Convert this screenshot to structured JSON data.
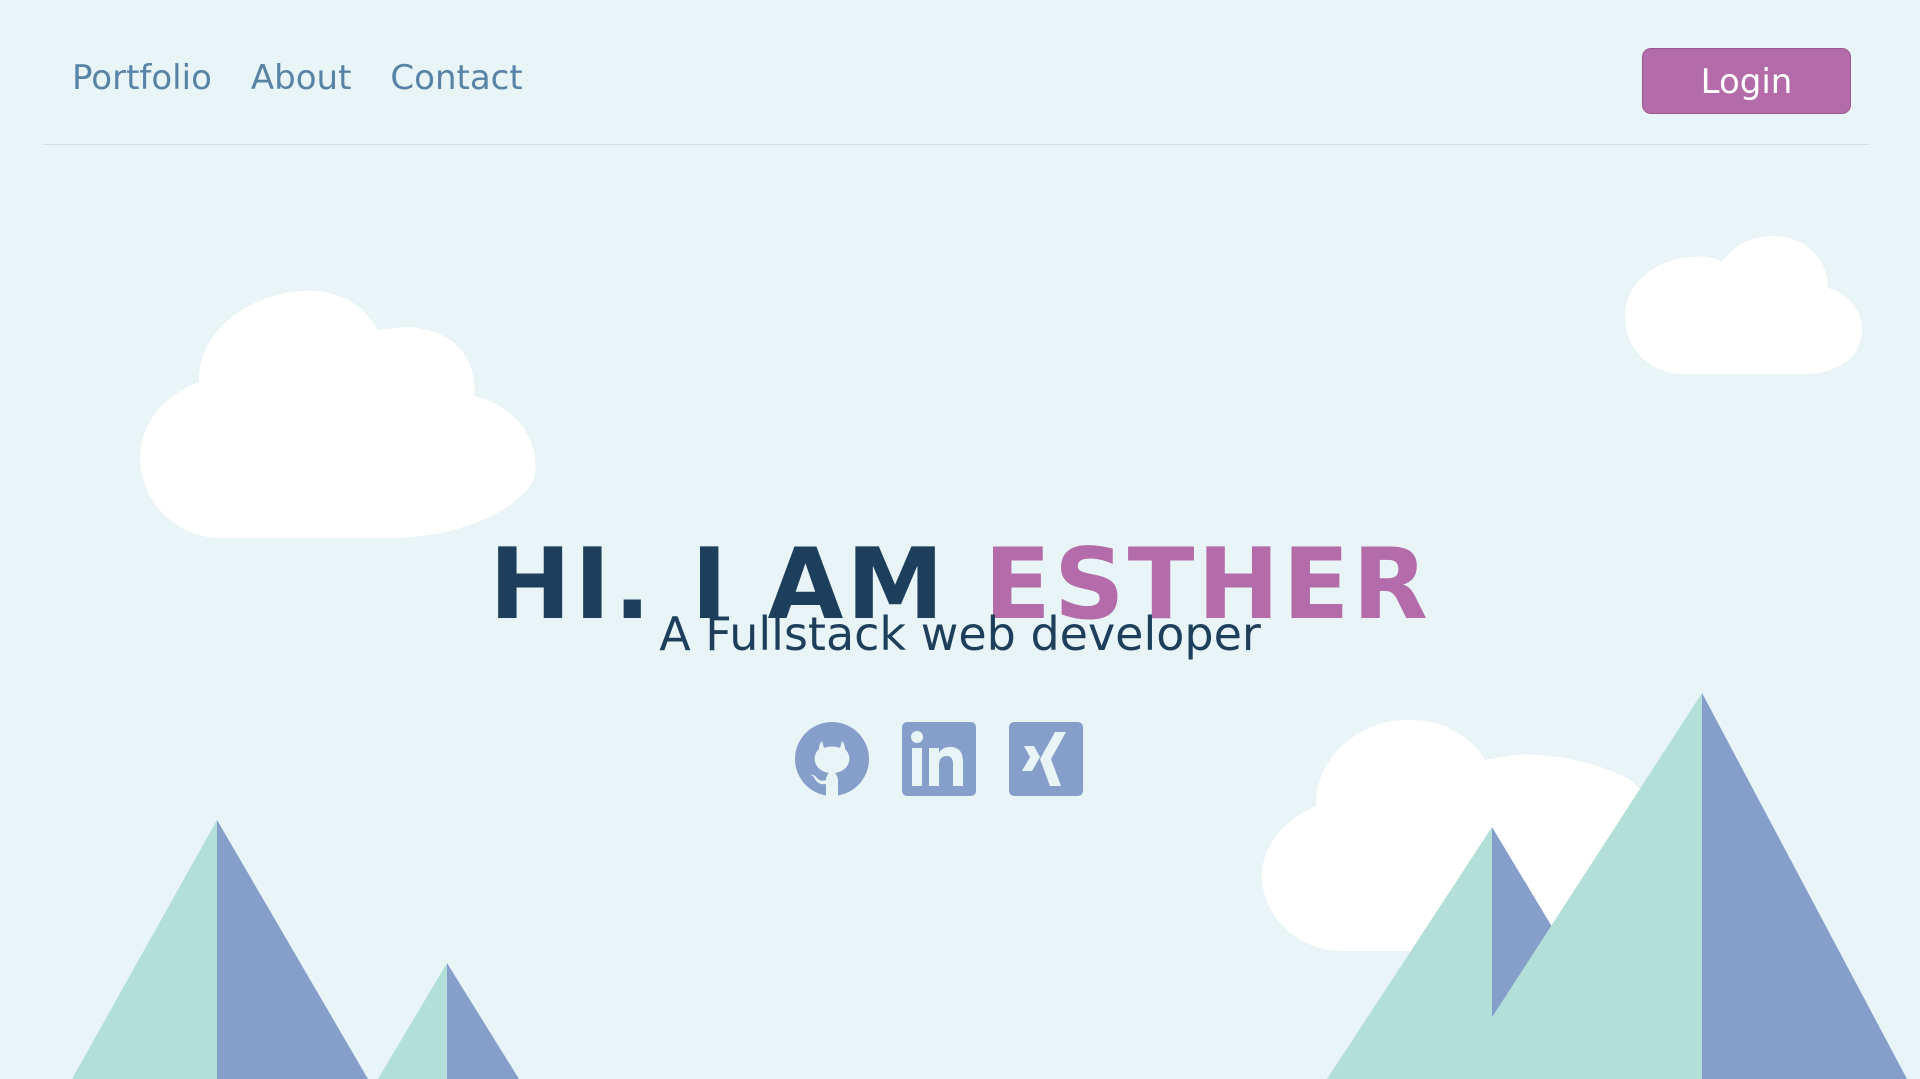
{
  "nav": {
    "links": [
      {
        "label": "Portfolio"
      },
      {
        "label": "About"
      },
      {
        "label": "Contact"
      }
    ],
    "login_label": "Login"
  },
  "hero": {
    "greeting": "HI. I AM",
    "name": "ESTHER",
    "subtitle": "A Fullstack web developer"
  },
  "social": [
    {
      "icon": "github-icon"
    },
    {
      "icon": "linkedin-icon"
    },
    {
      "icon": "xing-icon"
    }
  ],
  "colors": {
    "background": "#e8f4f6",
    "accent": "#b36ba9",
    "heading": "#1d3f5c",
    "nav_text": "#5783a6",
    "icon": "#869fca",
    "mountain_light": "#b2dfd7",
    "mountain_dark": "#869fca",
    "cloud": "#ffffff"
  }
}
